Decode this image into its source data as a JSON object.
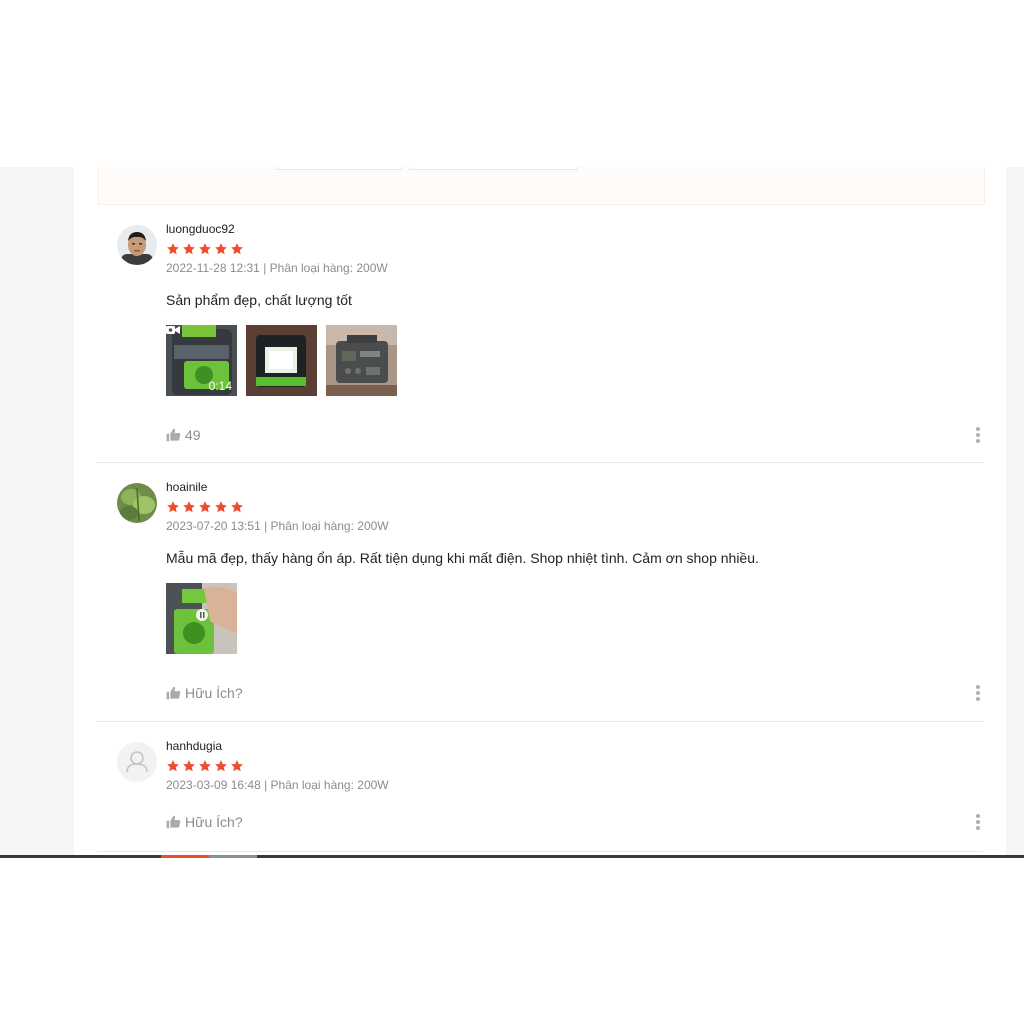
{
  "reviews": [
    {
      "username": "luongduoc92",
      "rating": 5,
      "meta": "2022-11-28 12:31 | Phân loại hàng: 200W",
      "text": "Sản phẩm đẹp, chất lượng tốt",
      "video_duration": "0:14",
      "likes": "49"
    },
    {
      "username": "hoainile",
      "rating": 5,
      "meta": "2023-07-20 13:51 | Phân loại hàng: 200W",
      "text": "Mẫu mã đẹp, thấy hàng ổn áp. Rất tiện dụng khi mất điện. Shop nhiệt tình. Cảm ơn shop nhiều.",
      "likes": "Hữu Ích?"
    },
    {
      "username": "hanhdugia",
      "rating": 5,
      "meta": "2023-03-09 16:48 | Phân loại hàng: 200W",
      "likes": "Hữu Ích?"
    }
  ],
  "colors": {
    "star": "#ee4d2d",
    "muted": "#8c8c8c"
  },
  "icons": {
    "like": "thumbs-up-icon",
    "more": "more-vertical-icon",
    "video": "video-camera-icon",
    "avatar_placeholder": "user-icon"
  }
}
